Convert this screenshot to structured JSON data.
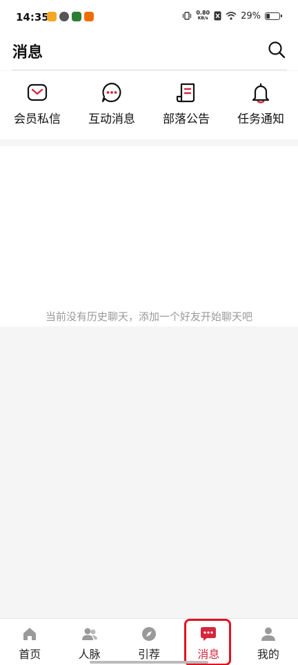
{
  "status_bar": {
    "time": "14:35",
    "net_speed_value": "0.80",
    "net_speed_unit": "KB/s",
    "battery_percent": "29%",
    "battery_level": 0.29,
    "icons": [
      "weibo-icon",
      "sync-icon",
      "app-icon",
      "app-icon",
      "vibrate-icon",
      "sim-off-icon",
      "wifi-icon",
      "battery-icon"
    ]
  },
  "header": {
    "title": "消息",
    "search_icon": "search-icon"
  },
  "quick_menu": [
    {
      "label": "会员私信",
      "icon": "mail-icon"
    },
    {
      "label": "互动消息",
      "icon": "chat-bubble-icon"
    },
    {
      "label": "部落公告",
      "icon": "document-icon"
    },
    {
      "label": "任务通知",
      "icon": "bell-icon"
    }
  ],
  "chat_list": {
    "empty_text": "当前没有历史聊天，添加一个好友开始聊天吧"
  },
  "tab_bar": {
    "items": [
      {
        "label": "首页",
        "icon": "home-icon"
      },
      {
        "label": "人脉",
        "icon": "contacts-icon"
      },
      {
        "label": "引荐",
        "icon": "compass-icon"
      },
      {
        "label": "消息",
        "icon": "message-icon",
        "active": true
      },
      {
        "label": "我的",
        "icon": "profile-icon"
      }
    ]
  },
  "colors": {
    "accent": "#d6263c",
    "highlight_border": "#e3101e",
    "icon_gray": "#9a9a9a",
    "empty_text": "#999999"
  }
}
